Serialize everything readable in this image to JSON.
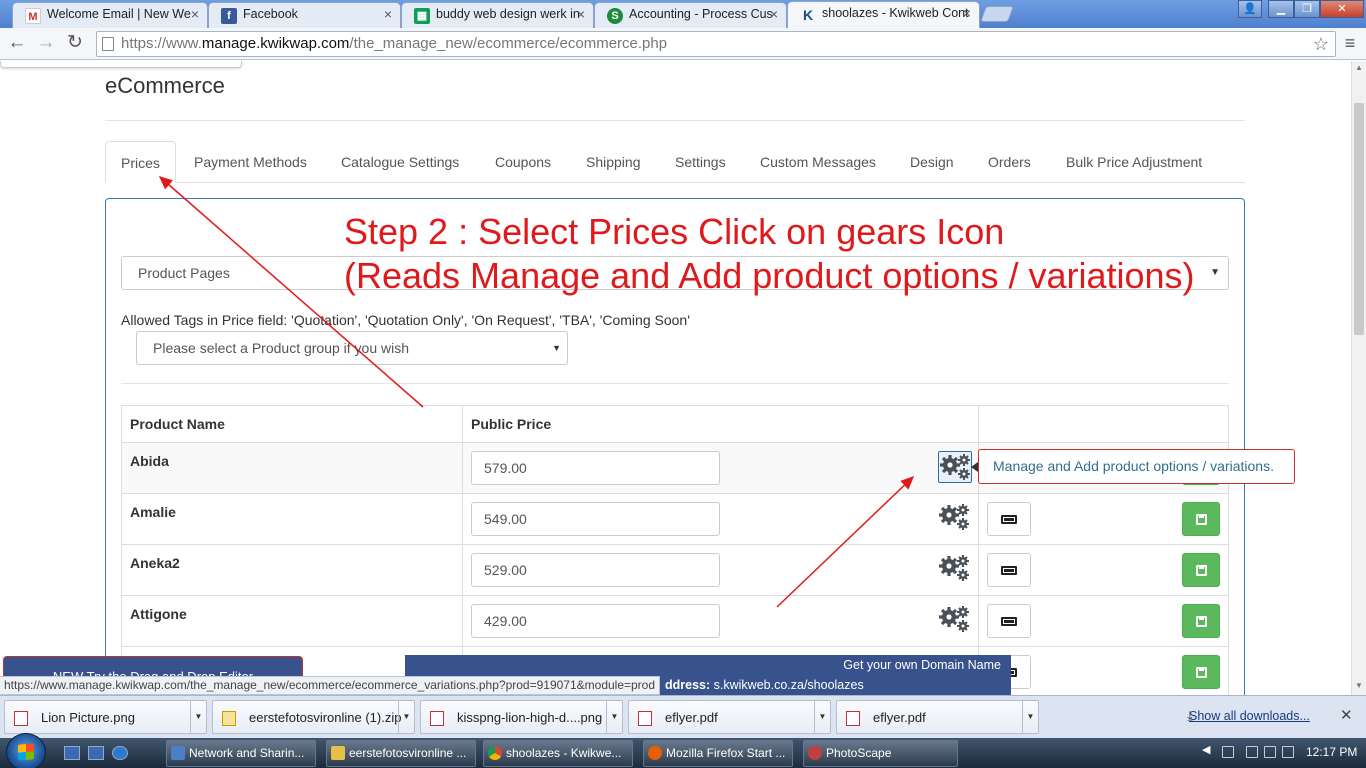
{
  "browser": {
    "tabs": [
      {
        "title": "Welcome Email | New We",
        "icon": "gmail-icon",
        "color": "#d93025"
      },
      {
        "title": "Facebook",
        "icon": "facebook-icon",
        "color": "#3b5998"
      },
      {
        "title": "buddy web design werk in",
        "icon": "sheets-icon",
        "color": "#0f9d58"
      },
      {
        "title": "Accounting - Process Cus",
        "icon": "smartsheet-icon",
        "color": "#1d8a3c"
      },
      {
        "title": "shoolazes - Kwikweb Cont",
        "icon": "kwikweb-icon",
        "color": "#1c4d8c"
      }
    ],
    "url_prefix": "https://www.",
    "url_domain": "manage.kwikwap.com",
    "url_path": "/the_manage_new/ecommerce/ecommerce.php",
    "status_url": "https://www.manage.kwikwap.com/the_manage_new/ecommerce/ecommerce_variations.php?prod=919071&module=prod"
  },
  "page": {
    "title": "eCommerce",
    "tabs": [
      "Prices",
      "Payment Methods",
      "Catalogue Settings",
      "Coupons",
      "Shipping",
      "Settings",
      "Custom Messages",
      "Design",
      "Orders",
      "Bulk Price Adjustment"
    ],
    "active_tab": "Prices",
    "page_select": "Product Pages",
    "allowed_tags": "Allowed Tags in Price field: 'Quotation', 'Quotation Only', 'On Request', 'TBA', 'Coming Soon'",
    "group_select": "Please select a Product group if you wish",
    "table": {
      "headers": [
        "Product Name",
        "Public Price",
        ""
      ],
      "rows": [
        {
          "name": "Abida",
          "price": "579.00"
        },
        {
          "name": "Amalie",
          "price": "549.00"
        },
        {
          "name": "Aneka2",
          "price": "529.00"
        },
        {
          "name": "Attigone",
          "price": "429.00"
        }
      ]
    },
    "tooltip": "Manage and Add product options / variations.",
    "annotation_line1": "Step 2 : Select Prices Click on gears Icon",
    "annotation_line2": "(Reads Manage and Add product options / variations)",
    "banner_domain": "Get your own Domain Name",
    "banner_address_label": "ddress:",
    "banner_address": "s.kwikweb.co.za/shoolazes",
    "drag_drop": "NEW Try the Drag and Drop Editor",
    "accent_red": "#e0191b",
    "accent_blue": "#337ab7",
    "save_green": "#5cb85c"
  },
  "downloads": {
    "items": [
      "Lion Picture.png",
      "eerstefotosvironline (1).zip",
      "kisspng-lion-high-d....png",
      "eflyer.pdf",
      "eflyer.pdf"
    ],
    "show_all": "Show all downloads..."
  },
  "taskbar": {
    "items": [
      "Network and Sharin...",
      "eerstefotosvironline ...",
      "shoolazes - Kwikwe...",
      "Mozilla Firefox Start ...",
      "PhotoScape"
    ],
    "clock": "12:17 PM"
  }
}
